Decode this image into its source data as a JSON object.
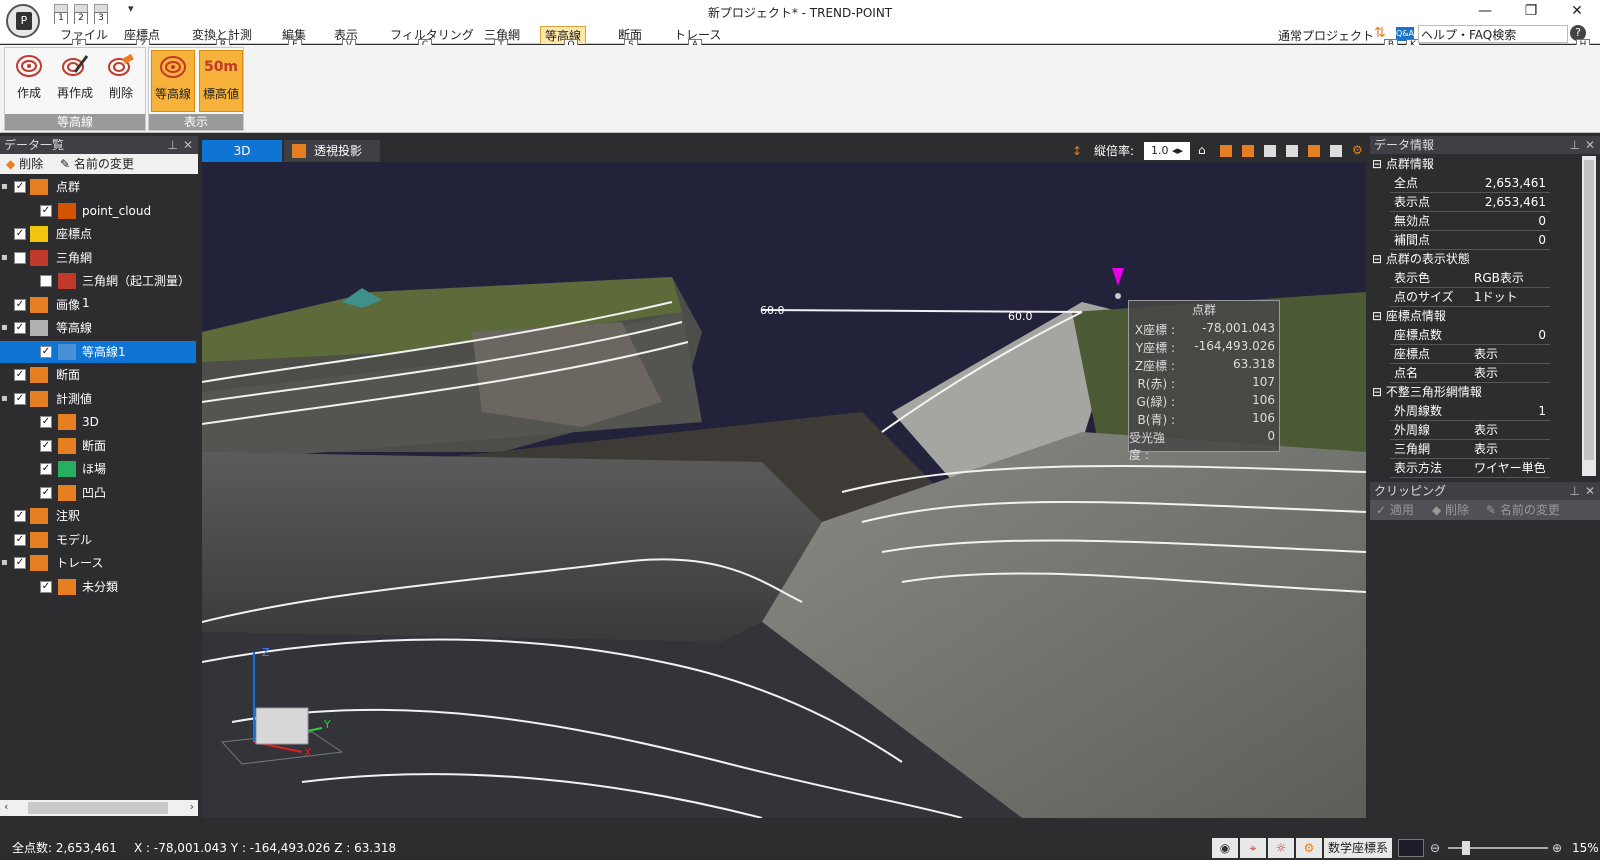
{
  "window": {
    "title": "新プロジェクト* - TREND-POINT"
  },
  "quick_access": {
    "keytip_1": "1",
    "keytip_2": "2",
    "keytip_3": "3"
  },
  "menu": [
    {
      "label": "ファイル",
      "key": "F"
    },
    {
      "label": "座標点",
      "key": "Z"
    },
    {
      "label": "変換と計測",
      "key": "R"
    },
    {
      "label": "編集",
      "key": "E"
    },
    {
      "label": "表示",
      "key": "V"
    },
    {
      "label": "フィルタリング",
      "key": "C"
    },
    {
      "label": "三角網",
      "key": "T"
    },
    {
      "label": "等高線",
      "key": "O"
    },
    {
      "label": "断面",
      "key": "S"
    },
    {
      "label": "トレース",
      "key": "A"
    }
  ],
  "menu_right": {
    "project": "通常プロジェクト",
    "key_b": "B",
    "key_k": "K",
    "help_search": "ヘルプ・FAQ検索",
    "key_h": "H",
    "qa_badge": "Q&A"
  },
  "ribbon": {
    "group1_label": "等高線",
    "group2_label": "表示",
    "create": "作成",
    "recreate": "再作成",
    "delete": "削除",
    "contour": "等高線",
    "elevation": "標高値",
    "elevation_icon_text": "50m"
  },
  "data_list": {
    "title": "データ一覧",
    "delete": "削除",
    "rename": "名前の変更",
    "items": [
      {
        "label": "点群",
        "checked": true
      },
      {
        "label": "point_cloud",
        "checked": true
      },
      {
        "label": "座標点",
        "checked": true
      },
      {
        "label": "三角網",
        "checked": false
      },
      {
        "label": "三角網（起工測量）1",
        "checked": false
      },
      {
        "label": "画像",
        "checked": true
      },
      {
        "label": "等高線",
        "checked": true
      },
      {
        "label": "等高線1",
        "checked": true
      },
      {
        "label": "断面",
        "checked": true
      },
      {
        "label": "計測値",
        "checked": true
      },
      {
        "label": "3D",
        "checked": true
      },
      {
        "label": "断面",
        "checked": true
      },
      {
        "label": "ほ場",
        "checked": true
      },
      {
        "label": "凹凸",
        "checked": true
      },
      {
        "label": "注釈",
        "checked": true
      },
      {
        "label": "モデル",
        "checked": true
      },
      {
        "label": "トレース",
        "checked": true
      },
      {
        "label": "未分類",
        "checked": true
      }
    ]
  },
  "view": {
    "tab_3d": "3D",
    "tab_perspective": "透視投影",
    "scale_label": "縦倍率:",
    "scale_value": "1.0",
    "contour_label_1": "60.0",
    "contour_label_2": "60.0",
    "axis_z": "Z",
    "axis_y": "Y",
    "axis_x": "X"
  },
  "point_tooltip": {
    "title": "点群",
    "rows": [
      {
        "k": "X座標 :",
        "v": "-78,001.043"
      },
      {
        "k": "Y座標 :",
        "v": "-164,493.026"
      },
      {
        "k": "Z座標 :",
        "v": "63.318"
      },
      {
        "k": "R(赤) :",
        "v": "107"
      },
      {
        "k": "G(緑) :",
        "v": "106"
      },
      {
        "k": "B(青) :",
        "v": "106"
      },
      {
        "k": "受光強度 :",
        "v": "0"
      }
    ]
  },
  "data_info": {
    "title": "データ情報",
    "sections": [
      {
        "title": "点群情報",
        "rows": [
          {
            "k": "全点",
            "v": "2,653,461",
            "num": true
          },
          {
            "k": "表示点",
            "v": "2,653,461",
            "num": true
          },
          {
            "k": "無効点",
            "v": "0",
            "num": true
          },
          {
            "k": "補間点",
            "v": "0",
            "num": true
          }
        ]
      },
      {
        "title": "点群の表示状態",
        "rows": [
          {
            "k": "表示色",
            "v": "RGB表示",
            "num": false
          },
          {
            "k": "点のサイズ",
            "v": "1ドット",
            "num": false
          }
        ]
      },
      {
        "title": "座標点情報",
        "rows": [
          {
            "k": "座標点数",
            "v": "0",
            "num": true
          },
          {
            "k": "座標点",
            "v": "表示",
            "num": false
          },
          {
            "k": "点名",
            "v": "表示",
            "num": false
          }
        ]
      },
      {
        "title": "不整三角形網情報",
        "rows": [
          {
            "k": "外周線数",
            "v": "1",
            "num": true
          },
          {
            "k": "外周線",
            "v": "表示",
            "num": false
          },
          {
            "k": "三角網",
            "v": "表示",
            "num": false
          },
          {
            "k": "表示方法",
            "v": "ワイヤー単色",
            "num": false
          }
        ]
      }
    ]
  },
  "clipping": {
    "title": "クリッピング",
    "apply": "適用",
    "delete": "削除",
    "rename": "名前の変更"
  },
  "status": {
    "total": "全点数: 2,653,461",
    "coords": "X : -78,001.043  Y : -164,493.026  Z : 63.318",
    "coord_system": "数学座標系",
    "zoom": "15%"
  },
  "colors": {
    "accent": "#0f75d4",
    "ribbon_active": "#f7b23b",
    "viewport_bg": "#22223a",
    "panel_bg": "#2d2d30"
  }
}
